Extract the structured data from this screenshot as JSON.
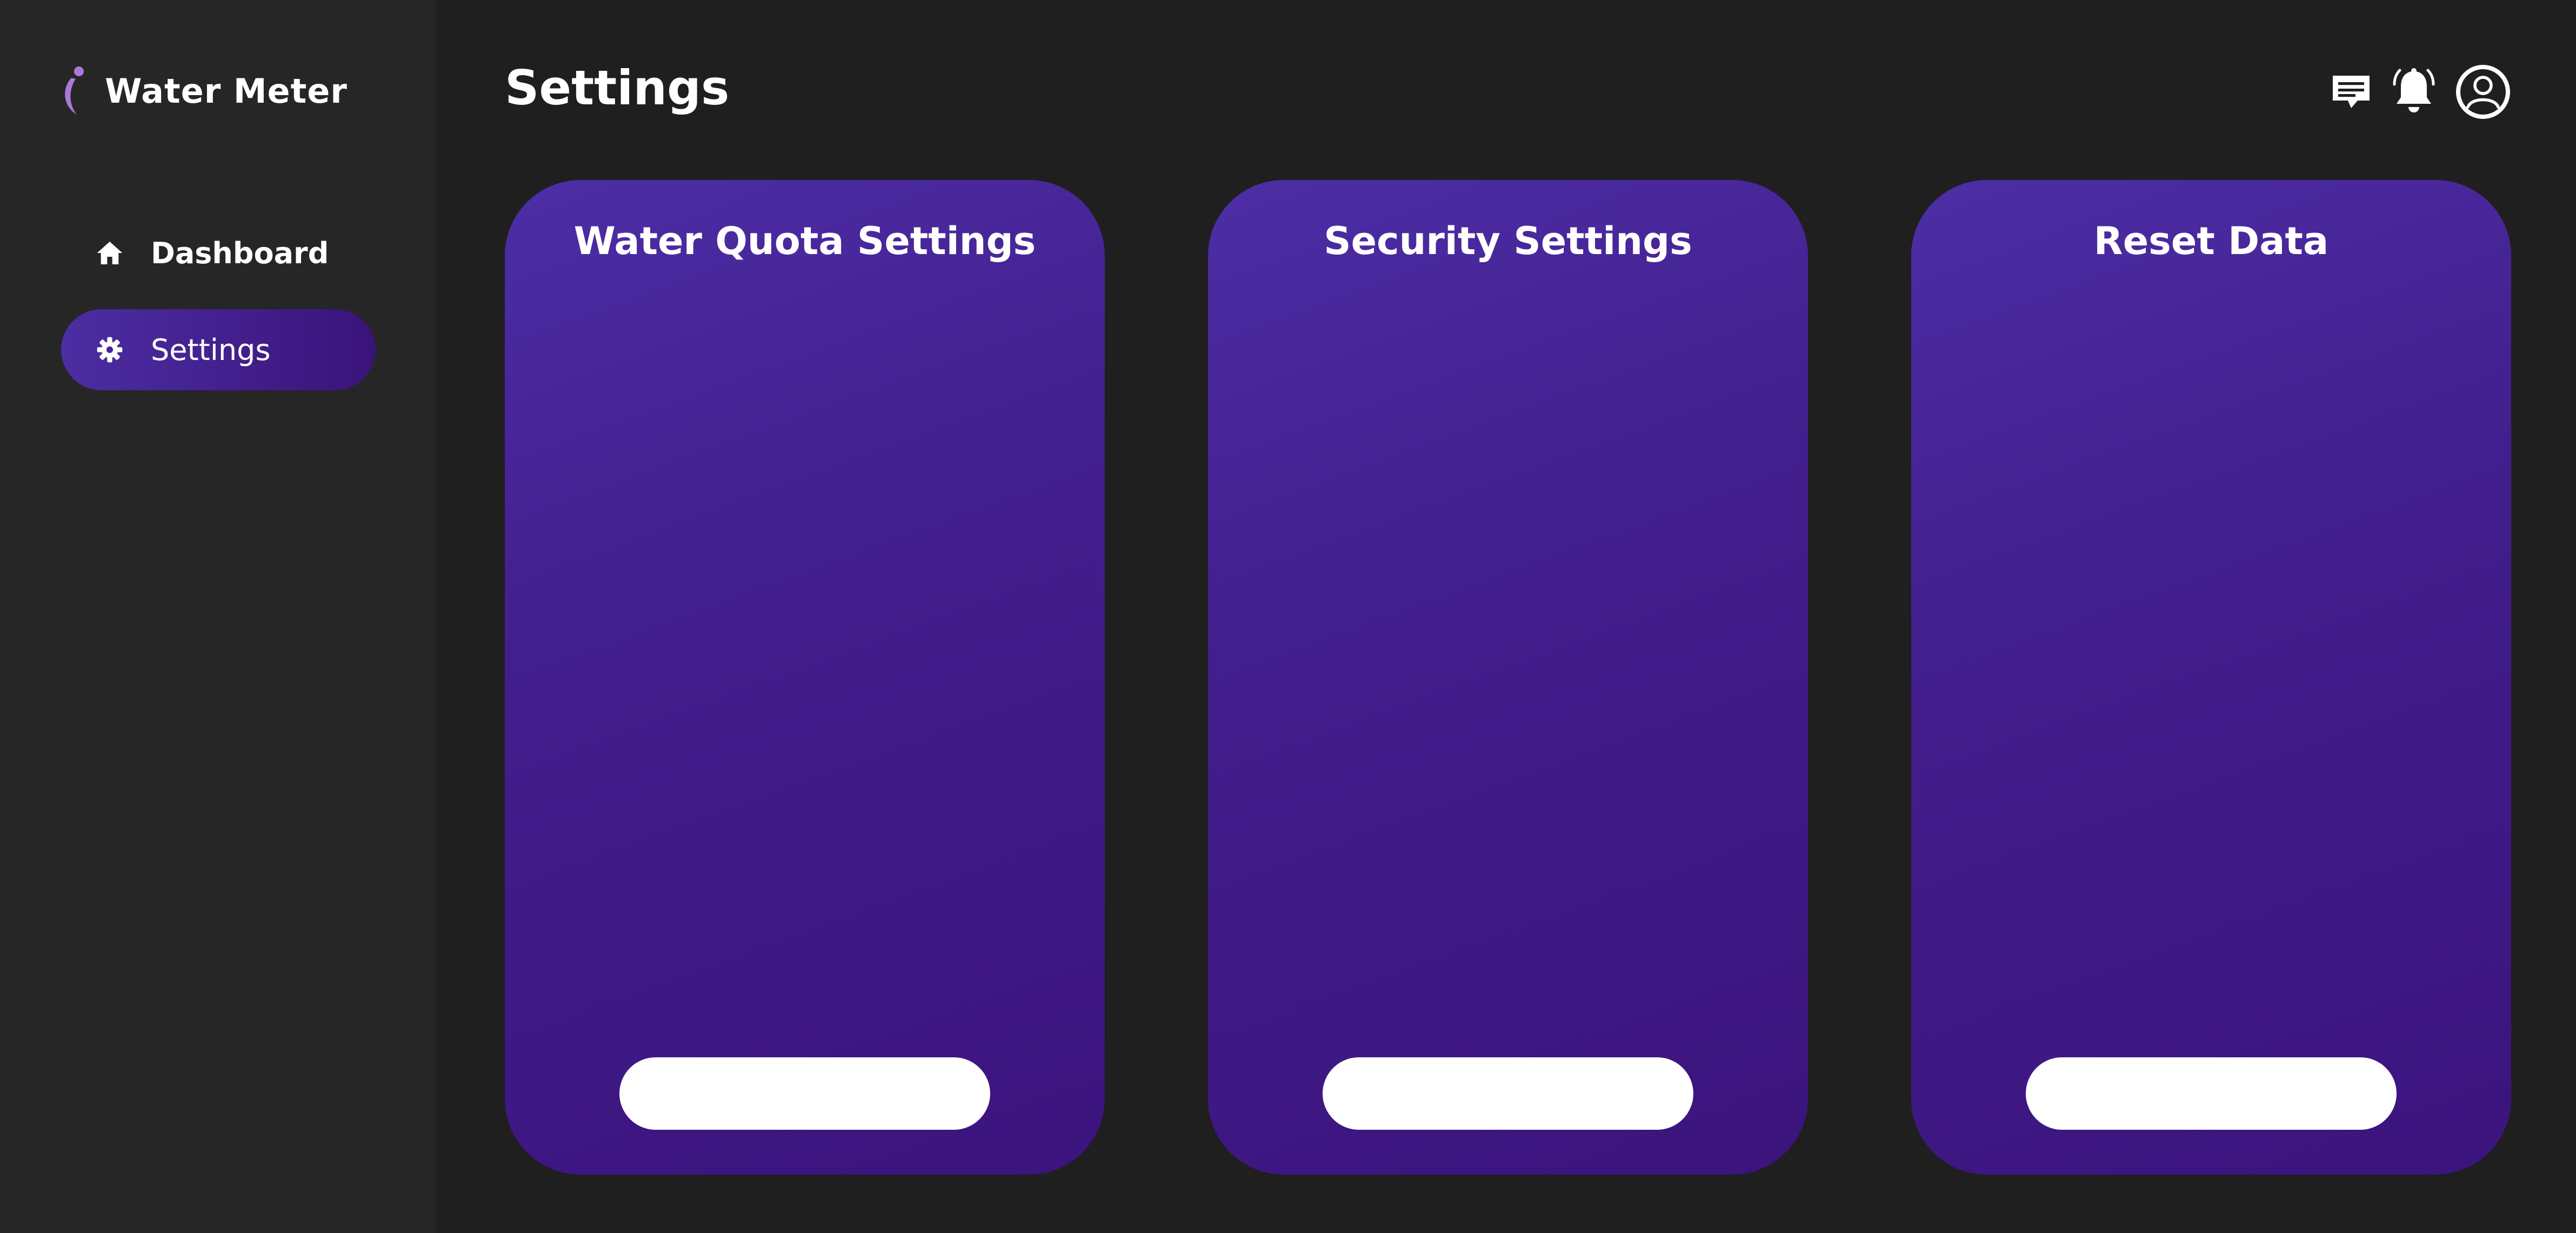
{
  "app": {
    "name": "Water Meter"
  },
  "sidebar": {
    "items": [
      {
        "label": "Dashboard",
        "icon": "home-icon",
        "active": false
      },
      {
        "label": "Settings",
        "icon": "gear-icon",
        "active": true
      }
    ]
  },
  "header": {
    "title": "Settings",
    "icons": [
      "chat-icon",
      "bell-icon",
      "user-icon"
    ]
  },
  "cards": [
    {
      "title": "Water Quota Settings",
      "button_label": ""
    },
    {
      "title": "Security Settings",
      "button_label": ""
    },
    {
      "title": "Reset Data",
      "button_label": ""
    }
  ],
  "colors": {
    "background": "#1f1f1f",
    "sidebar": "#262626",
    "accent_start": "#4d2ea6",
    "accent_end": "#3b137d",
    "logo_accent": "#a77ad9",
    "text": "#ffffff"
  }
}
